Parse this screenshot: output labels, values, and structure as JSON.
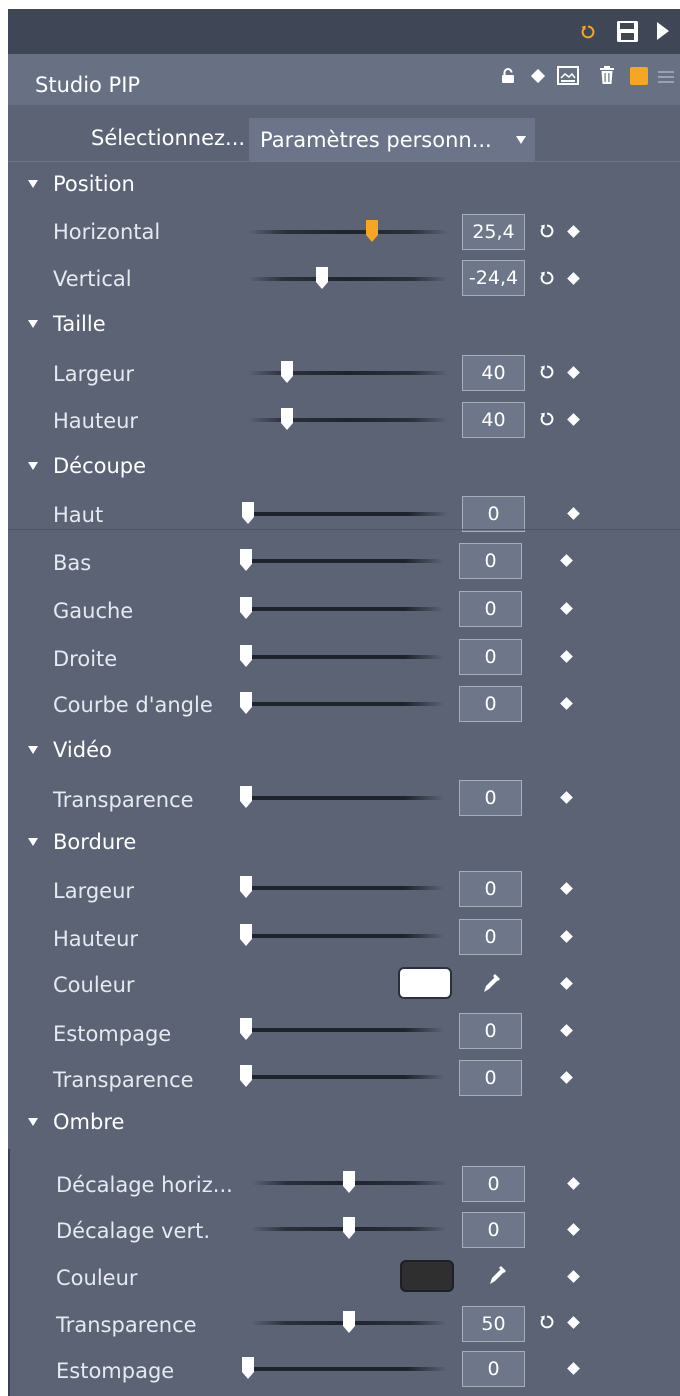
{
  "panel": {
    "title": "Studio PIP",
    "preset_label": "Sélectionnez...",
    "preset_value": "Paramètres personn...",
    "toolbar_icons": [
      "reset-icon",
      "save-icon",
      "play-icon"
    ],
    "title_icons": [
      "lock-icon",
      "keyframe-diamond-icon",
      "overlay-icon",
      "trash-icon",
      "color-square-icon",
      "menu-icon"
    ],
    "accent_color": "#f5a623"
  },
  "sections": {
    "position": {
      "label": "Position",
      "horizontal": {
        "label": "Horizontal",
        "value": "25,4"
      },
      "vertical": {
        "label": "Vertical",
        "value": "-24,4"
      }
    },
    "taille": {
      "label": "Taille",
      "largeur": {
        "label": "Largeur",
        "value": "40"
      },
      "hauteur": {
        "label": "Hauteur",
        "value": "40"
      }
    },
    "decoupe": {
      "label": "Découpe",
      "haut": {
        "label": "Haut",
        "value": "0"
      },
      "bas": {
        "label": "Bas",
        "value": "0"
      },
      "gauche": {
        "label": "Gauche",
        "value": "0"
      },
      "droite": {
        "label": "Droite",
        "value": "0"
      },
      "courbe": {
        "label": "Courbe d'angle",
        "value": "0"
      }
    },
    "video": {
      "label": "Vidéo",
      "transparence": {
        "label": "Transparence",
        "value": "0"
      }
    },
    "bordure": {
      "label": "Bordure",
      "largeur": {
        "label": "Largeur",
        "value": "0"
      },
      "hauteur": {
        "label": "Hauteur",
        "value": "0"
      },
      "couleur": {
        "label": "Couleur",
        "color": "#ffffff"
      },
      "estompage": {
        "label": "Estompage",
        "value": "0"
      },
      "transparence": {
        "label": "Transparence",
        "value": "0"
      }
    },
    "ombre": {
      "label": "Ombre",
      "decalage_h": {
        "label": "Décalage horiz...",
        "value": "0"
      },
      "decalage_v": {
        "label": "Décalage vert.",
        "value": "0"
      },
      "couleur": {
        "label": "Couleur",
        "color": "#2f2f2f"
      },
      "transparence": {
        "label": "Transparence",
        "value": "50"
      },
      "estompage": {
        "label": "Estompage",
        "value": "0"
      }
    }
  }
}
